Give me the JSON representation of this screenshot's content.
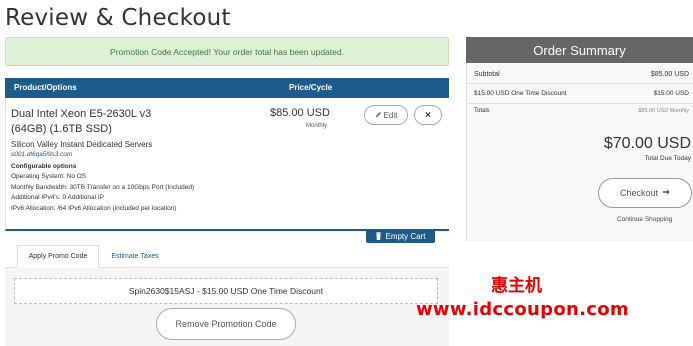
{
  "page": {
    "title": "Review & Checkout"
  },
  "alert": {
    "message": "Promotion Code Accepted! Your order total has been updated."
  },
  "cart": {
    "headers": {
      "product": "Product/Options",
      "price": "Price/Cycle"
    },
    "item": {
      "name_line1": "Dual Intel Xeon E5-2630L v3",
      "name_line2": "(64GB) (1.6TB SSD)",
      "group": "Silicon Valley Instant Dedicated Servers",
      "domain": "s001.dl6qa5l9s3.com",
      "config_title": "Configurable options",
      "config": [
        "Operating System: No OS",
        "Monthly Bandwidth: 30TB Transfer on a 10Gbps Port (Included)",
        "Additional IPv4's: 0 Additional IP",
        "IPv6 Allocation: /64 IPv6 Allocation (included per location)"
      ],
      "price": "$85.00 USD",
      "cycle": "Monthly",
      "edit_label": "Edit",
      "remove_label": "×"
    },
    "empty_cart_label": "Empty Cart"
  },
  "tabs": [
    {
      "label": "Apply Promo Code",
      "active": true
    },
    {
      "label": "Estimate Taxes",
      "active": false
    }
  ],
  "promo": {
    "code_text": "Spin2630$15ASJ - $15.00 USD One Time Discount",
    "remove_label": "Remove Promotion Code"
  },
  "summary": {
    "title": "Order Summary",
    "subtotal_label": "Subtotal",
    "subtotal_value": "$85.00 USD",
    "discount_label": "$15.00 USD One Time Discount",
    "discount_value": "$15.00 USD",
    "totals_label": "Totals",
    "totals_value": "$85.00 USD Monthly",
    "total": "$70.00 USD",
    "total_due_label": "Total Due Today",
    "checkout_label": "Checkout",
    "continue_label": "Continue Shopping"
  },
  "watermark": {
    "cn": "惠主机",
    "url": "www.idccoupon.com"
  },
  "colors": {
    "primary": "#1c5b8a",
    "alert_bg": "#dff0d8",
    "alert_text": "#3c763d",
    "summary_header": "#666666",
    "watermark": "#e60000"
  },
  "icons": {
    "edit": "pencil-icon",
    "remove": "close-icon",
    "empty_cart": "trash-icon",
    "checkout": "arrow-right-icon"
  }
}
